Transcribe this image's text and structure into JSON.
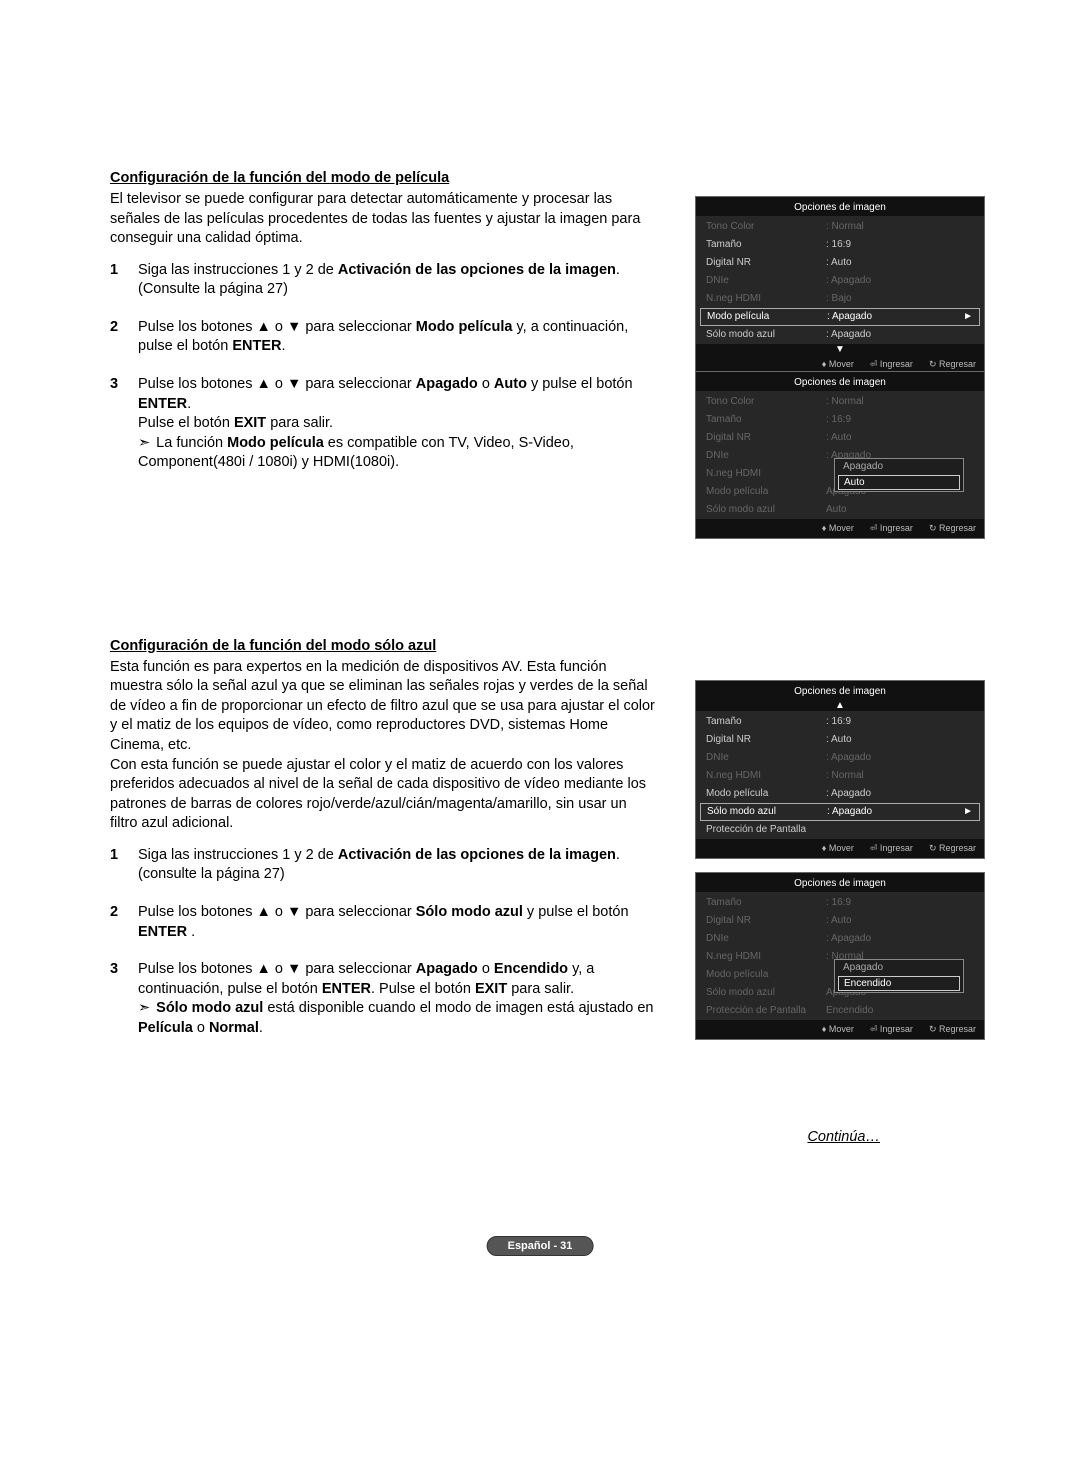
{
  "section1": {
    "title": "Configuración de la función del modo de película",
    "intro": "El televisor se puede configurar para detectar automáticamente y procesar las señales de las películas procedentes de todas las fuentes y ajustar la imagen para conseguir una calidad óptima.",
    "step1_a": "Siga las instrucciones 1 y 2 de ",
    "step1_b": "Activación de las opciones de la imagen",
    "step1_c": ". (Consulte la página 27)",
    "step2_a": "Pulse los botones ▲ o ▼ para seleccionar ",
    "step2_b": "Modo película",
    "step2_c": " y, a continuación, pulse el botón ",
    "step2_d": "ENTER",
    "step2_e": ".",
    "step3_a": "Pulse los botones ▲ o ▼ para seleccionar ",
    "step3_b": "Apagado",
    "step3_c": " o ",
    "step3_d": "Auto",
    "step3_e": " y pulse el botón ",
    "step3_f": "ENTER",
    "step3_g": ".",
    "step3_exit_a": "Pulse el botón ",
    "step3_exit_b": "EXIT",
    "step3_exit_c": " para salir.",
    "step3_note_a": "La función ",
    "step3_note_b": "Modo película",
    "step3_note_c": " es compatible con TV, Video, S-Video, Component(480i / 1080i) y HDMI(1080i)."
  },
  "section2": {
    "title": "Configuración de la función del modo sólo azul",
    "intro": "Esta función es para expertos en la medición de dispositivos AV. Esta función muestra sólo la señal azul ya que se eliminan las señales rojas y verdes de la señal de vídeo a fin de proporcionar un efecto de filtro azul que se usa para ajustar el color y el matiz de los equipos de vídeo, como reproductores DVD, sistemas Home Cinema, etc.",
    "intro2": "Con esta función se puede ajustar el color y el matiz de acuerdo con los valores preferidos adecuados al nivel de la señal de cada dispositivo de vídeo mediante los patrones de barras de colores rojo/verde/azul/cián/magenta/amarillo, sin usar un filtro azul adicional.",
    "step1_a": "Siga las instrucciones 1 y 2 de ",
    "step1_b": "Activación de las opciones de la imagen",
    "step1_c": ". (consulte la página 27)",
    "step2_a": "Pulse los botones ▲ o ▼ para seleccionar ",
    "step2_b": "Sólo modo azul",
    "step2_c": " y pulse el botón ",
    "step2_d": "ENTER",
    "step2_e": " .",
    "step3_a": "Pulse los botones ▲ o ▼ para seleccionar ",
    "step3_b": "Apagado",
    "step3_c": " o ",
    "step3_d": "Encendido",
    "step3_e": " y, a continuación, pulse el botón ",
    "step3_f": "ENTER",
    "step3_g": ". Pulse el botón ",
    "step3_h": "EXIT",
    "step3_i": " para salir.",
    "step3_note_a": "Sólo modo azul",
    "step3_note_b": " está disponible cuando el modo de imagen está ajustado en ",
    "step3_note_c": "Película",
    "step3_note_d": " o ",
    "step3_note_e": "Normal",
    "step3_note_f": "."
  },
  "osd": {
    "title": "Opciones de imagen",
    "mover": "Mover",
    "ingresar": "Ingresar",
    "regresar": "Regresar",
    "panel1": [
      {
        "label": "Tono Color",
        "val": ": Normal",
        "dim": true
      },
      {
        "label": "Tamaño",
        "val": ": 16:9"
      },
      {
        "label": "Digital NR",
        "val": ": Auto"
      },
      {
        "label": "DNIe",
        "val": ": Apagado",
        "dim": true
      },
      {
        "label": "N.neg HDMI",
        "val": ": Bajo",
        "dim": true
      },
      {
        "label": "Modo película",
        "val": ": Apagado",
        "active": true,
        "arrow": true
      },
      {
        "label": "Sólo modo azul",
        "val": ": Apagado"
      }
    ],
    "panel1_scroll": "▼",
    "panel2": [
      {
        "label": "Tono Color",
        "val": ": Normal",
        "dim": true
      },
      {
        "label": "Tamaño",
        "val": ": 16:9",
        "dim": true
      },
      {
        "label": "Digital NR",
        "val": ": Auto",
        "dim": true
      },
      {
        "label": "DNIe",
        "val": ": Apagado",
        "dim": true
      },
      {
        "label": "N.neg HDMI",
        "val": "",
        "dim": true
      },
      {
        "label": "Modo película",
        "val": "Apagado",
        "dim": true
      },
      {
        "label": "Sólo modo azul",
        "val": "Auto",
        "dim": true
      }
    ],
    "panel2_sub": [
      {
        "t": "Apagado"
      },
      {
        "t": "Auto",
        "sel": true
      }
    ],
    "panel3": [
      {
        "label": "Tamaño",
        "val": ": 16:9"
      },
      {
        "label": "Digital NR",
        "val": ": Auto"
      },
      {
        "label": "DNIe",
        "val": ": Apagado",
        "dim": true
      },
      {
        "label": "N.neg HDMI",
        "val": ": Normal",
        "dim": true
      },
      {
        "label": "Modo película",
        "val": ": Apagado"
      },
      {
        "label": "Sólo modo azul",
        "val": ": Apagado",
        "active": true,
        "arrow": true
      },
      {
        "label": "Protección de Pantalla",
        "val": ""
      }
    ],
    "panel3_scroll": "▲",
    "panel4": [
      {
        "label": "Tamaño",
        "val": ": 16:9",
        "dim": true
      },
      {
        "label": "Digital NR",
        "val": ": Auto",
        "dim": true
      },
      {
        "label": "DNIe",
        "val": ": Apagado",
        "dim": true
      },
      {
        "label": "N.neg HDMI",
        "val": ": Normal",
        "dim": true
      },
      {
        "label": "Modo película",
        "val": "",
        "dim": true
      },
      {
        "label": "Sólo modo azul",
        "val": "Apagado",
        "dim": true
      },
      {
        "label": "Protección de Pantalla",
        "val": "Encendido",
        "dim": true
      }
    ],
    "panel4_sub": [
      {
        "t": "Apagado"
      },
      {
        "t": "Encendido",
        "sel": true
      }
    ]
  },
  "continue": "Continúa…",
  "pagebadge": "Español - 31"
}
